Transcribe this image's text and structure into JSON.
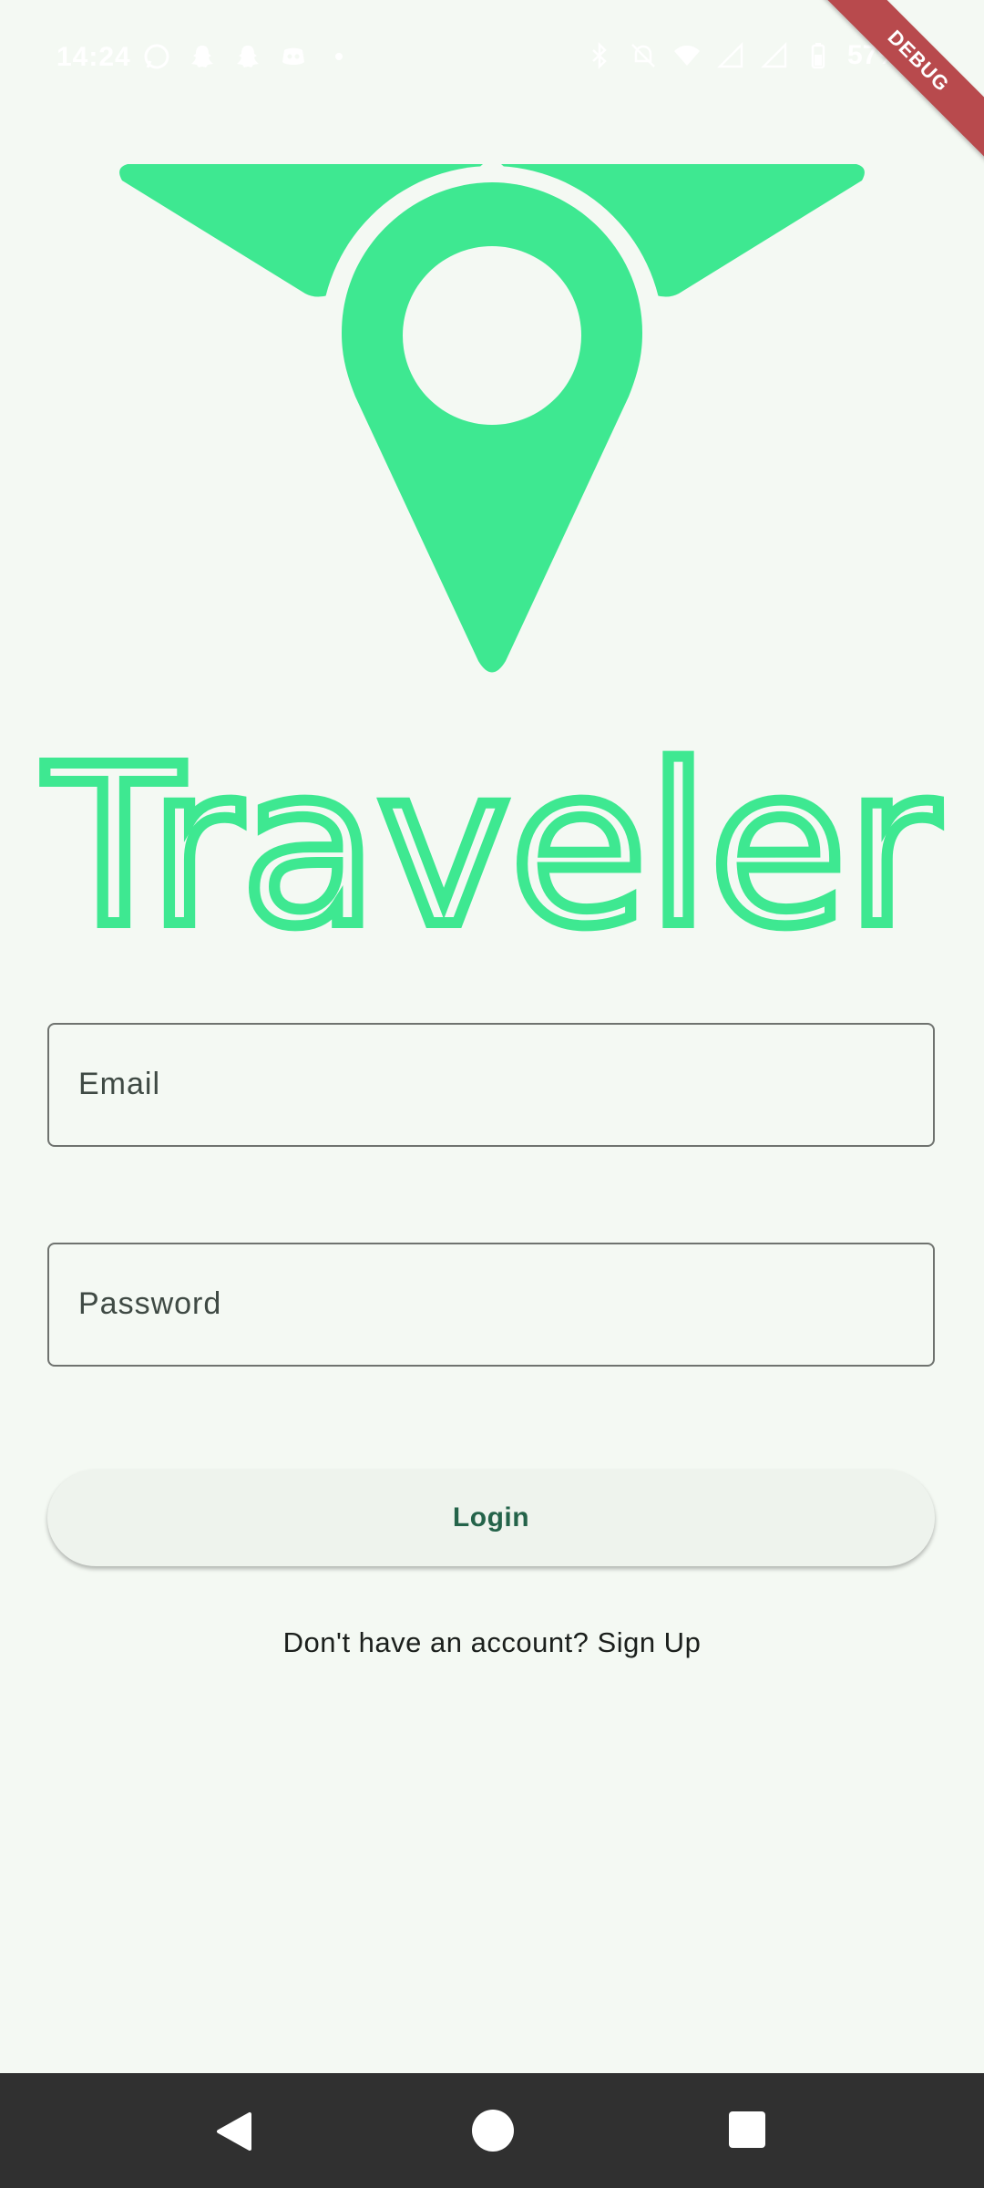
{
  "status_bar": {
    "time": "14:24",
    "battery": "57%",
    "left_icons": [
      "whatsapp-icon",
      "snapchat-icon",
      "snapchat-icon",
      "discord-icon",
      "dot-icon"
    ],
    "right_icons": [
      "bluetooth-icon",
      "mute-icon",
      "wifi-icon",
      "signal-icon",
      "signal-icon",
      "battery-icon"
    ]
  },
  "debug_banner": "DEBUG",
  "app": {
    "title": "Traveler",
    "brand_color": "#3ee891"
  },
  "form": {
    "email_label": "Email",
    "password_label": "Password",
    "login_label": "Login",
    "signup_text": "Don't have an account? Sign Up"
  },
  "nav_bar": {
    "buttons": [
      "back-icon",
      "home-icon",
      "recents-icon"
    ]
  }
}
